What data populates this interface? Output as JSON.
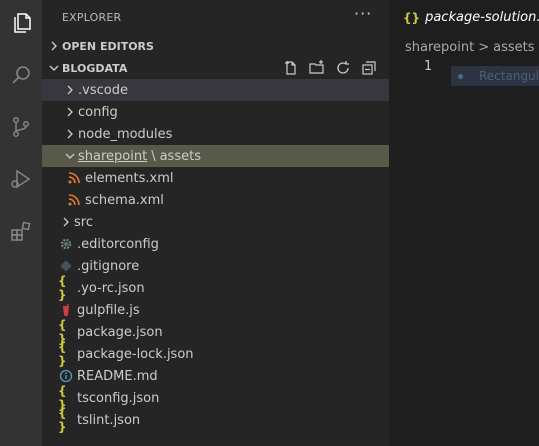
{
  "activity_bar": {
    "icons": [
      "files-icon",
      "search-icon",
      "source-control-icon",
      "run-debug-icon",
      "extensions-icon"
    ]
  },
  "sidebar": {
    "title": "EXPLORER",
    "more_label": "···",
    "open_editors_label": "OPEN EDITORS",
    "project_label": "BLOGDATA",
    "items": [
      {
        "label": ".vscode",
        "type": "folder"
      },
      {
        "label": "config",
        "type": "folder"
      },
      {
        "label": "node_modules",
        "type": "folder"
      },
      {
        "label_parent": "sharepoint",
        "separator": "\\",
        "label_child": "assets",
        "type": "folder-open"
      },
      {
        "label": "elements.xml",
        "type": "xml"
      },
      {
        "label": "schema.xml",
        "type": "xml"
      },
      {
        "label": "src",
        "type": "folder"
      },
      {
        "label": ".editorconfig",
        "type": "gear"
      },
      {
        "label": ".gitignore",
        "type": "git"
      },
      {
        "label": ".yo-rc.json",
        "type": "json"
      },
      {
        "label": "gulpfile.js",
        "type": "gulp"
      },
      {
        "label": "package.json",
        "type": "json"
      },
      {
        "label": "package-lock.json",
        "type": "json"
      },
      {
        "label": "README.md",
        "type": "info"
      },
      {
        "label": "tsconfig.json",
        "type": "json"
      },
      {
        "label": "tslint.json",
        "type": "json"
      }
    ]
  },
  "editor": {
    "tab_label": "package-solution.json",
    "tab_icon": "{}",
    "breadcrumbs": [
      "sharepoint",
      "assets"
    ],
    "breadcrumb_sep": ">",
    "line_number": "1",
    "ghost_text": "Rectangul"
  },
  "colors": {
    "json_icon": "#cbcb41",
    "xml_icon": "#e37933",
    "info_icon": "#519aba",
    "gulp_icon": "#cc3e44",
    "gear_icon": "#6d8086",
    "selected_row": "#59594a"
  }
}
